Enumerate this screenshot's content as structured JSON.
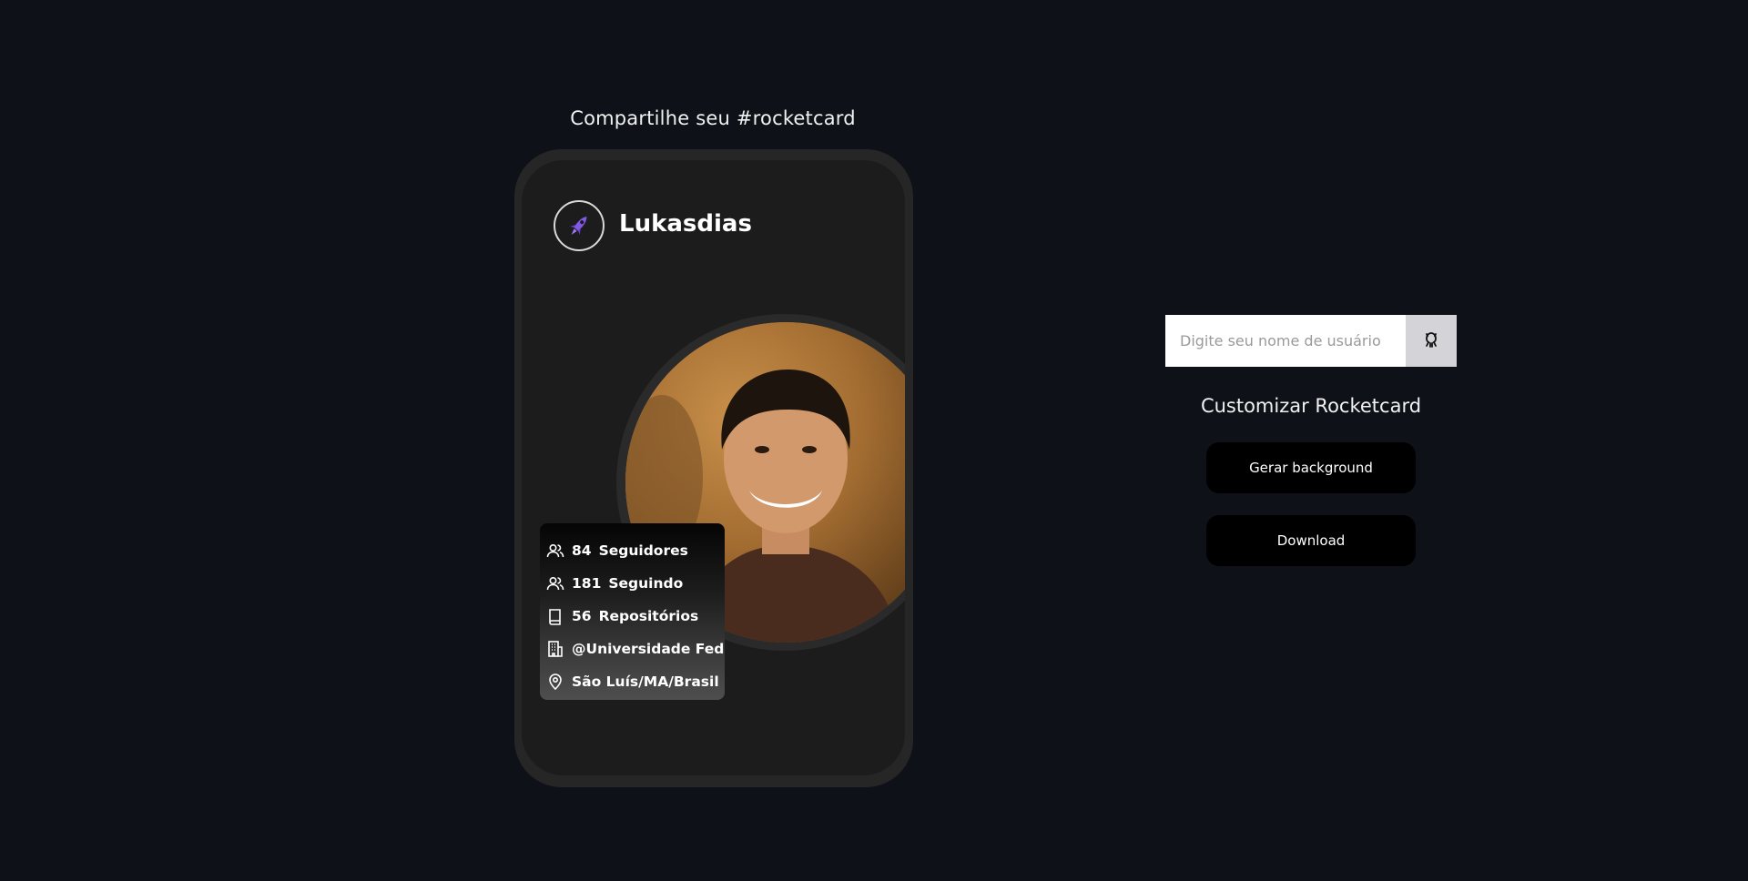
{
  "share_title": "Compartilhe seu #rocketcard",
  "card": {
    "username": "Lukasdias",
    "stats": [
      {
        "icon": "users-icon",
        "value": "84",
        "label": "Seguidores"
      },
      {
        "icon": "users-icon",
        "value": "181",
        "label": "Seguindo"
      },
      {
        "icon": "repo-icon",
        "value": "56",
        "label": "Repositórios"
      },
      {
        "icon": "building-icon",
        "value": "",
        "label": "@Universidade Fed"
      },
      {
        "icon": "location-pin-icon",
        "value": "",
        "label": "São Luís/MA/Brasil"
      }
    ]
  },
  "search": {
    "placeholder": "Digite seu nome de usuário",
    "button_icon": "github-octocat-icon"
  },
  "customize": {
    "title": "Customizar Rocketcard",
    "generate_label": "Gerar background",
    "download_label": "Download"
  },
  "colors": {
    "background": "#0e1117",
    "card_frame": "#262626",
    "card_inner": "#1c1c1c",
    "button": "#000000",
    "logo_accent": "#8257e5"
  }
}
